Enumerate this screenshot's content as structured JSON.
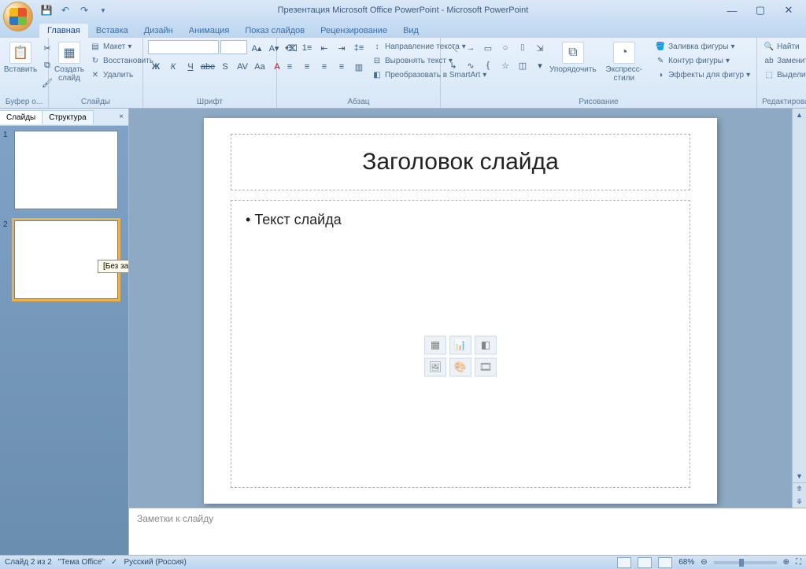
{
  "title": "Презентация Microsoft Office PowerPoint - Microsoft PowerPoint",
  "tabs": {
    "home": "Главная",
    "insert": "Вставка",
    "design": "Дизайн",
    "animation": "Анимация",
    "slideshow": "Показ слайдов",
    "review": "Рецензирование",
    "view": "Вид"
  },
  "ribbon": {
    "clipboard": {
      "label": "Буфер о...",
      "paste": "Вставить"
    },
    "slides": {
      "label": "Слайды",
      "new": "Создать\nслайд",
      "layout": "Макет",
      "reset": "Восстановить",
      "delete": "Удалить"
    },
    "font": {
      "label": "Шрифт",
      "bold": "Ж",
      "italic": "К",
      "underline": "Ч",
      "strike": "abe",
      "shadow": "S",
      "spacing": "AV",
      "case": "Aa"
    },
    "paragraph": {
      "label": "Абзац",
      "textdir": "Направление текста",
      "align": "Выровнять текст",
      "smartart": "Преобразовать в SmartArt"
    },
    "drawing": {
      "label": "Рисование",
      "arrange": "Упорядочить",
      "styles": "Экспресс-стили",
      "fill": "Заливка фигуры",
      "outline": "Контур фигуры",
      "effects": "Эффекты для фигур"
    },
    "editing": {
      "label": "Редактирование",
      "find": "Найти",
      "replace": "Заменить",
      "select": "Выделить"
    }
  },
  "sidebar": {
    "slides_tab": "Слайды",
    "outline_tab": "Структура",
    "tooltip": "[Без заголовка]",
    "thumb1": "1",
    "thumb2": "2"
  },
  "slide": {
    "title": "Заголовок слайда",
    "body": "Текст слайда"
  },
  "notes": {
    "placeholder": "Заметки к слайду"
  },
  "status": {
    "slide": "Слайд 2 из 2",
    "theme": "\"Тема Office\"",
    "lang": "Русский (Россия)",
    "zoom": "68%"
  }
}
